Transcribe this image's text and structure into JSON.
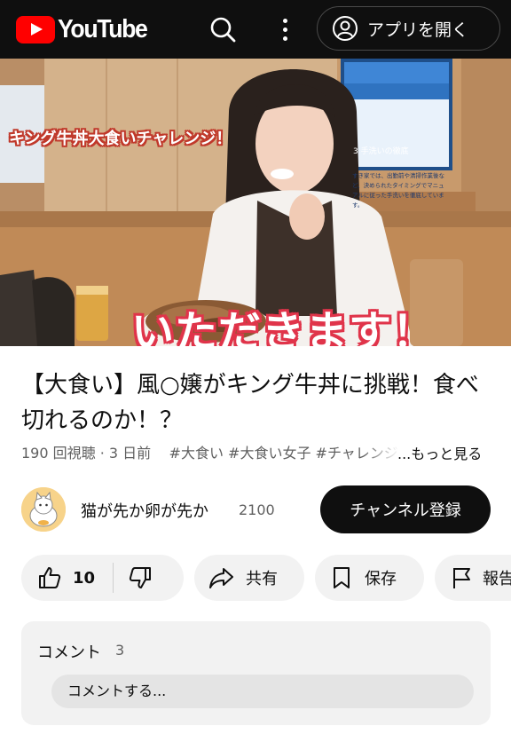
{
  "header": {
    "logo_text": "YouTube",
    "search_icon": "search-icon",
    "more_icon": "more-vert-icon",
    "open_app_label": "アプリを開く"
  },
  "thumbnail": {
    "title_tag": "キング牛丼大食いチャレンジ！",
    "caption": "いただきます！",
    "screen_heading": "3 手洗いの徹底",
    "screen_body": "すき家では、出勤前や清掃作業後など、決められたタイミングでマニュアルに従った手洗いを徹底しています。"
  },
  "video": {
    "title": "【大食い】風○嬢がキング牛丼に挑戦！食べ切れるのか！？",
    "views": "190 回視聴",
    "age": "3 日前",
    "tags": "#大食い #大食い女子 #チャレンジ",
    "more_label": "...もっと見る"
  },
  "channel": {
    "name": "猫が先か卵が先か",
    "subscribers": "2100",
    "subscribe_label": "チャンネル登録"
  },
  "actions": {
    "like_count": "10",
    "share_label": "共有",
    "save_label": "保存",
    "report_label": "報告"
  },
  "comments": {
    "label": "コメント",
    "count": "3",
    "input_placeholder": "コメントする..."
  },
  "colors": {
    "brand_red": "#ff0000",
    "header_bg": "#0f0f0f",
    "pill_bg": "#f2f2f2"
  }
}
